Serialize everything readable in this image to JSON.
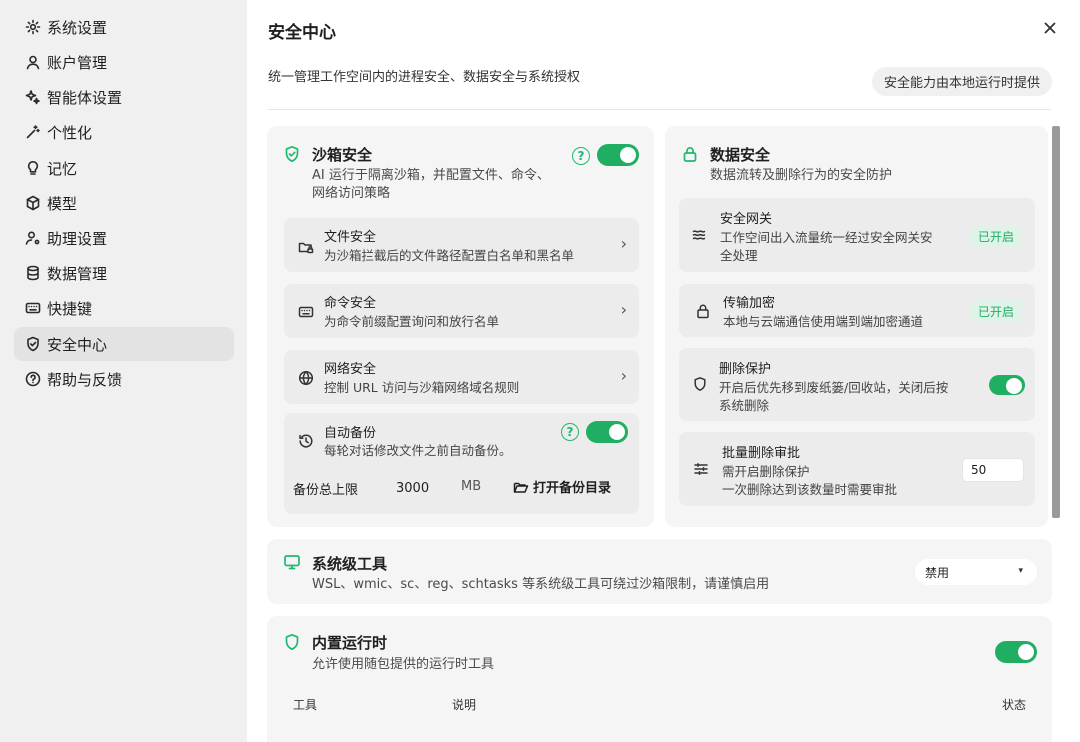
{
  "sidebar": {
    "items": [
      {
        "label": "系统设置",
        "icon": "gear-icon"
      },
      {
        "label": "账户管理",
        "icon": "user-icon"
      },
      {
        "label": "智能体设置",
        "icon": "sparkle-icon"
      },
      {
        "label": "个性化",
        "icon": "magic-wand-icon"
      },
      {
        "label": "记忆",
        "icon": "lightbulb-icon"
      },
      {
        "label": "模型",
        "icon": "cube-icon"
      },
      {
        "label": "助理设置",
        "icon": "user-gear-icon"
      },
      {
        "label": "数据管理",
        "icon": "database-icon"
      },
      {
        "label": "快捷键",
        "icon": "keyboard-icon"
      },
      {
        "label": "安全中心",
        "icon": "shield-icon",
        "active": true
      },
      {
        "label": "帮助与反馈",
        "icon": "help-circle-icon"
      }
    ]
  },
  "header": {
    "title": "安全中心",
    "description": "统一管理工作空间内的进程安全、数据安全与系统授权",
    "local_note": "安全能力由本地运行时提供"
  },
  "sandbox": {
    "title": "沙箱安全",
    "subtitle_line1": "AI 运行于隔离沙箱，并配置文件、命令、",
    "subtitle_line2": "网络访问策略",
    "enabled": true,
    "help": "?",
    "rows": [
      {
        "title": "文件安全",
        "desc": "为沙箱拦截后的文件路径配置白名单和黑名单",
        "icon": "folder-lock-icon",
        "chevron": "›"
      },
      {
        "title": "命令安全",
        "desc": "为命令前缀配置询问和放行名单",
        "icon": "keyboard-icon",
        "chevron": "›"
      },
      {
        "title": "网络安全",
        "desc": "控制 URL 访问与沙箱网络域名规则",
        "icon": "globe-icon",
        "chevron": "›"
      }
    ],
    "backup": {
      "title": "自动备份",
      "desc": "每轮对话修改文件之前自动备份。",
      "enabled": true,
      "help": "?",
      "limit_label": "备份总上限",
      "limit_value": "3000",
      "limit_unit": "MB",
      "open_dir_label": "打开备份目录"
    }
  },
  "data_security": {
    "title": "数据安全",
    "subtitle": "数据流转及删除行为的安全防护",
    "rows": [
      {
        "title": "安全网关",
        "desc_line1": "工作空间出入流量统一经过安全网关安",
        "desc_line2": "全处理",
        "icon": "waves-icon",
        "badge": "已开启"
      },
      {
        "title": "传输加密",
        "desc_line1": "本地与云端通信使用端到端加密通道",
        "icon": "lock-icon",
        "badge": "已开启"
      },
      {
        "title": "删除保护",
        "desc_line1": "开启后优先移到废纸篓/回收站，关闭后按",
        "desc_line2": "系统删除",
        "icon": "shield-icon",
        "enabled": true
      },
      {
        "title": "批量删除审批",
        "desc_line1": "需开启删除保护",
        "desc_line2": "一次删除达到该数量时需要审批",
        "icon": "sliders-icon",
        "value": "50"
      }
    ]
  },
  "system_tools": {
    "title": "系统级工具",
    "desc": "WSL、wmic、sc、reg、schtasks 等系统级工具可绕过沙箱限制，请谨慎启用",
    "select_value": "禁用",
    "caret": "▾"
  },
  "builtin_runtime": {
    "title": "内置运行时",
    "desc": "允许使用随包提供的运行时工具",
    "enabled": true,
    "columns": [
      "工具",
      "说明",
      "状态"
    ]
  },
  "colors": {
    "accent": "#1fae62",
    "sidebar_bg": "#f0f0f0",
    "card_bg": "#f5f5f5"
  }
}
